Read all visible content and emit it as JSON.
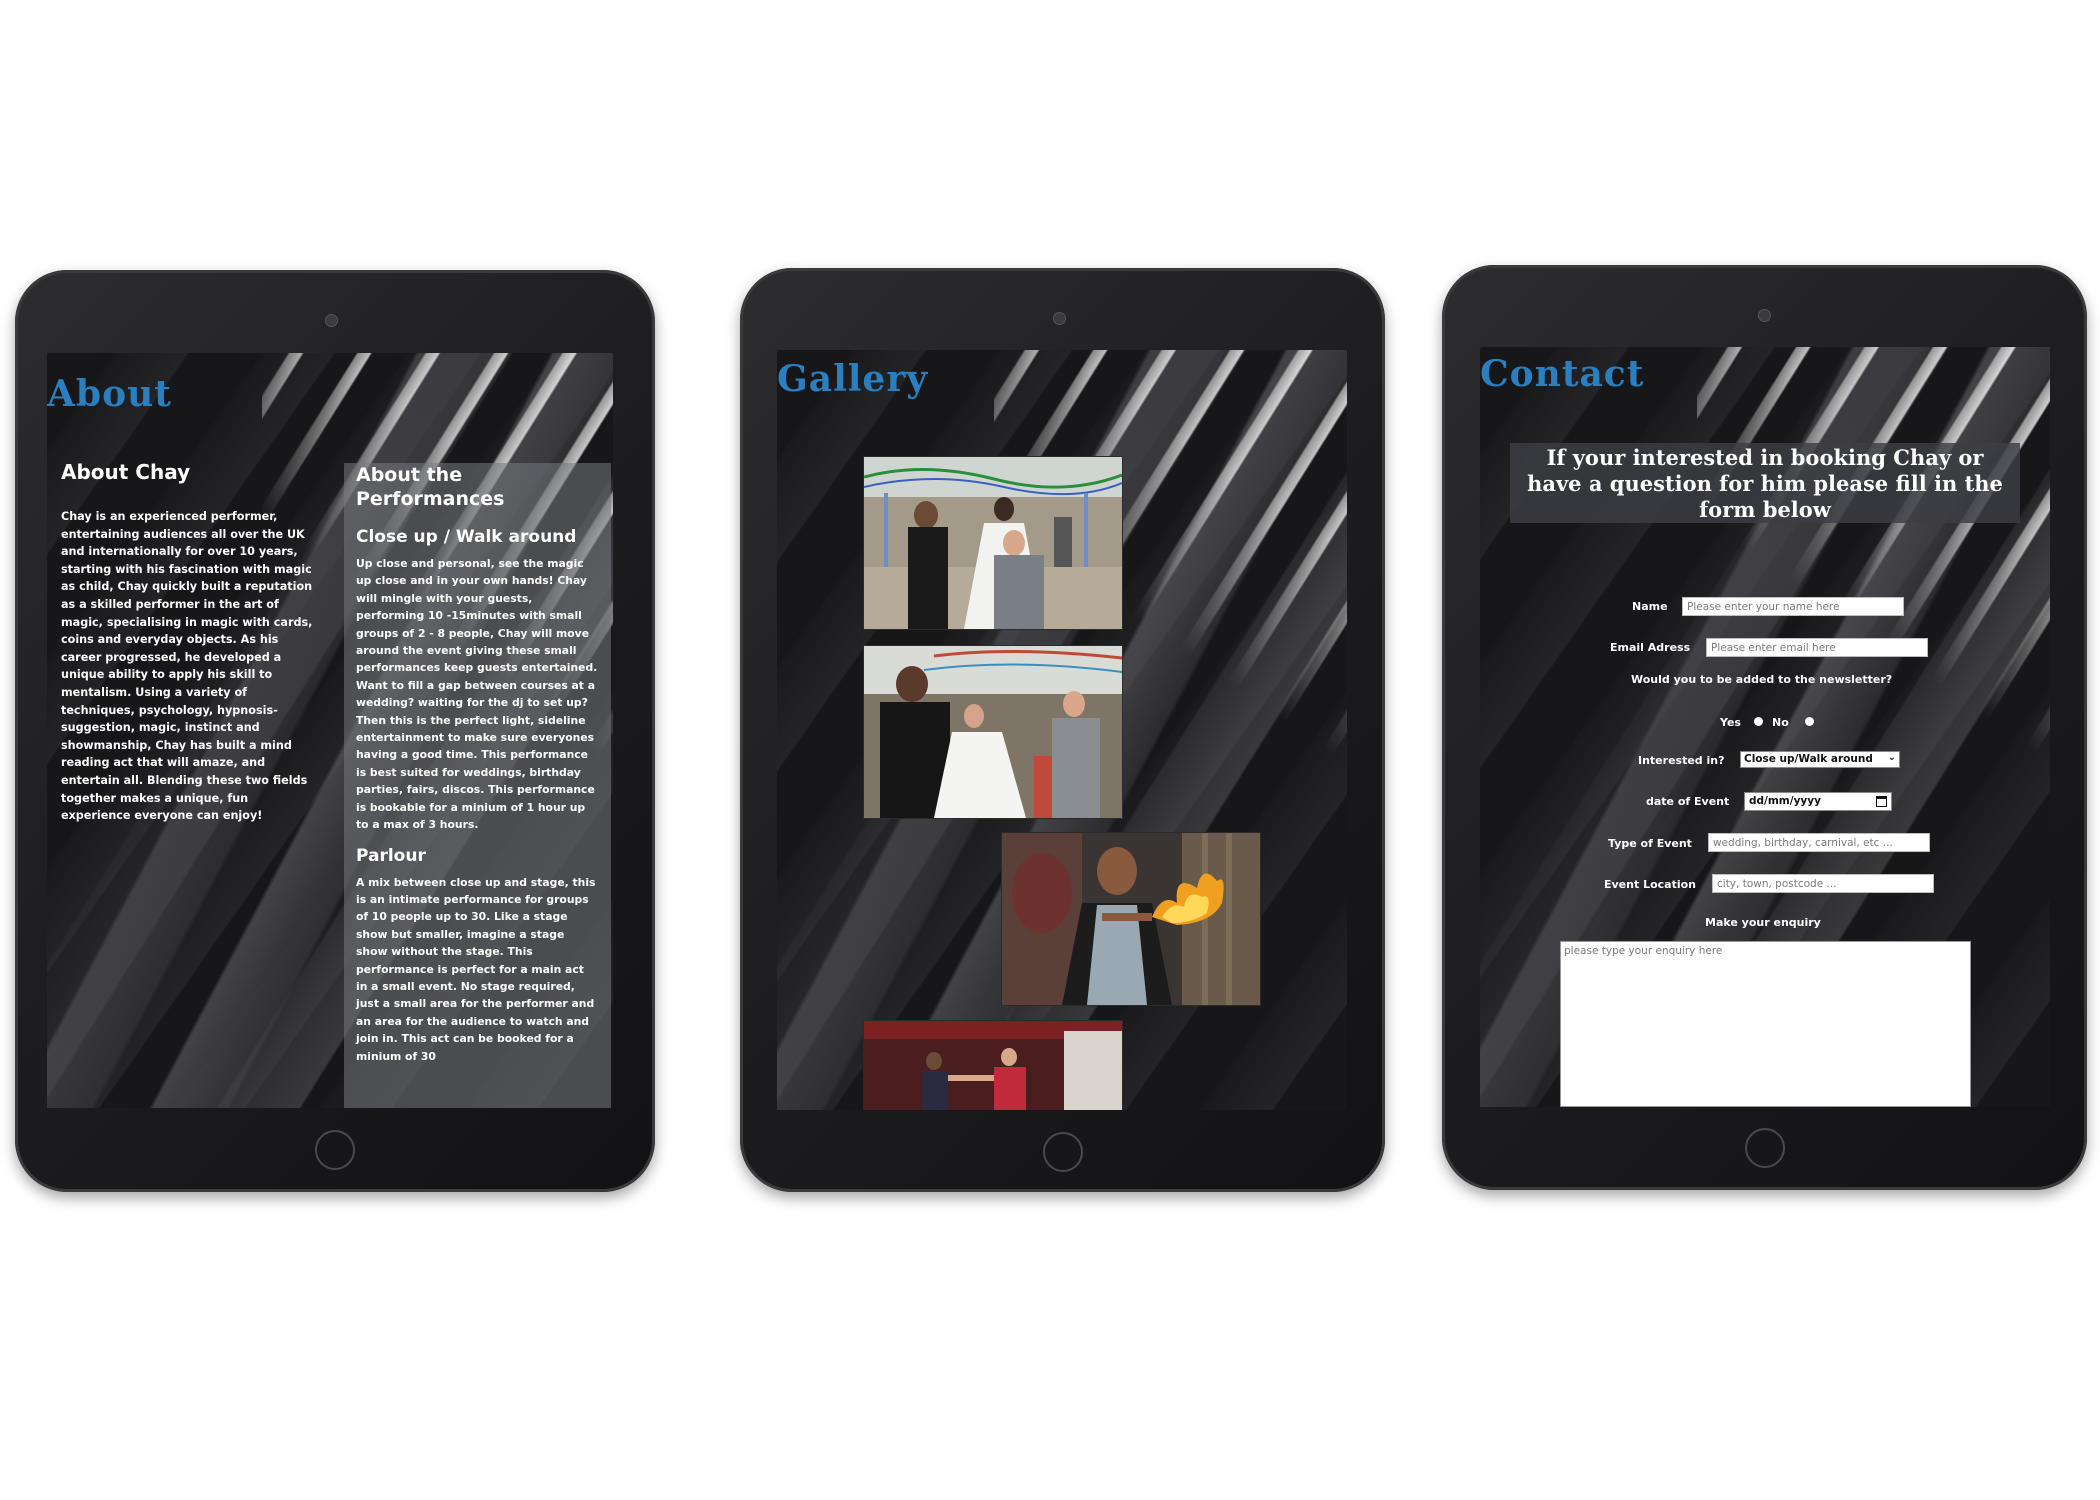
{
  "about": {
    "page_title": "About",
    "left_heading": "About Chay",
    "bio": "Chay is an experienced performer, entertaining audiences all over the UK and internationally for over 10 years, starting with his fascination with magic as child, Chay quickly built a reputation as a skilled performer in the art of magic, specialising in magic with cards, coins and everyday objects. As his career progressed, he developed a unique ability to apply his skill to mentalism. Using a variety of techniques, psychology, hypnosis-suggestion, magic, instinct and showmanship, Chay has built a mind reading act that will amaze, and entertain all. Blending these two fields together makes a unique, fun experience everyone can enjoy!",
    "right_heading": "About the Performances",
    "closeup_heading": "Close up / Walk around",
    "closeup_text": "Up close and personal, see the magic up close and in your own hands! Chay will mingle with your guests, performing 10 -15minutes with small groups of 2 - 8 people, Chay will move around the event giving these small performances keep guests entertained. Want to fill a gap between courses at a wedding? waiting for the dj to set up? Then this is the perfect light, sideline entertainment to make sure everyones having a good time. This performance is best suited for weddings, birthday parties, fairs, discos. This performance is bookable for a minium of 1 hour up to a max of 3 hours.",
    "parlour_heading": "Parlour",
    "parlour_text": "A mix between close up and stage, this is an intimate performance for groups of 10 people up to 30. Like a stage show but smaller, imagine a stage show without the stage. This performance is perfect for a main act in a small event. No stage required, just a small area for the performer and an area for the audience to watch and join in. This act can be booked for a minium of 30"
  },
  "gallery": {
    "page_title": "Gallery",
    "photos": [
      {
        "name": "wedding-card-trick-photo"
      },
      {
        "name": "wedding-guests-photo"
      },
      {
        "name": "fire-trick-photo"
      },
      {
        "name": "stage-performance-photo"
      }
    ]
  },
  "contact": {
    "page_title": "Contact",
    "banner": "If your interested in booking Chay or have a question for him please fill in the form below",
    "name_label": "Name",
    "name_placeholder": "Please enter your name here",
    "email_label": "Email Adress",
    "email_placeholder": "Please enter email here",
    "newsletter_question": "Would you to be added to the newsletter?",
    "yes_label": "Yes",
    "no_label": "No",
    "interest_label": "Interested in?",
    "interest_selected": "Close up/Walk around",
    "date_label": "date of Event",
    "date_placeholder": "dd/mm/yyyy",
    "type_label": "Type of Event",
    "type_placeholder": "wedding, birthday, carnival, etc ...",
    "location_label": "Event Location",
    "location_placeholder": "city, town, postcode ...",
    "enquiry_label": "Make your enquiry",
    "enquiry_placeholder": "please type your enquiry here"
  },
  "colors": {
    "title_blue": "#2a7fc0",
    "device_frame": "#1e1e20",
    "screen_bg": "#111113"
  }
}
